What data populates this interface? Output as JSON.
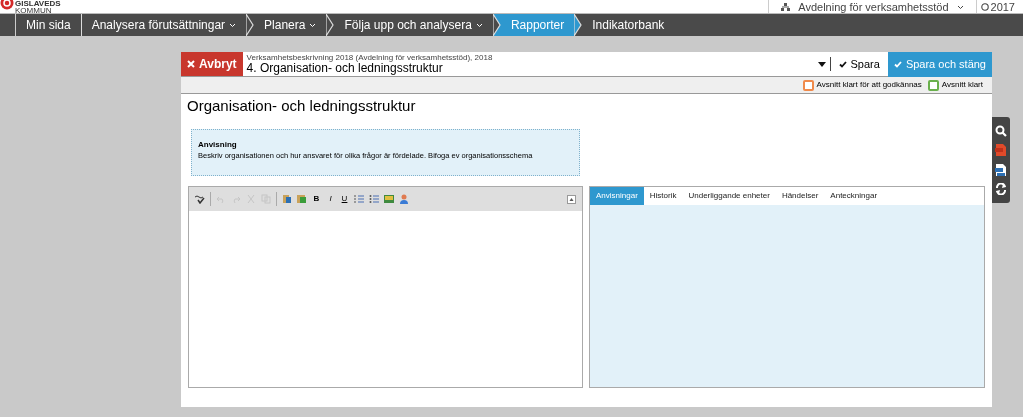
{
  "logo": {
    "line_1": "GISLAVEDS",
    "line_2": "KOMMUN"
  },
  "org_selector": {
    "label": "Avdelning för verksamhetsstöd"
  },
  "year": {
    "label": "2017"
  },
  "nav": [
    {
      "label": "Min sida",
      "has_dropdown": false,
      "selected": false
    },
    {
      "label": "Analysera förutsättningar",
      "has_dropdown": true,
      "selected": false
    },
    {
      "label": "Planera",
      "has_dropdown": true,
      "selected": false
    },
    {
      "label": "Följa upp och analysera",
      "has_dropdown": true,
      "selected": false
    },
    {
      "label": "Rapporter",
      "has_dropdown": false,
      "selected": true
    },
    {
      "label": "Indikatorbank",
      "has_dropdown": false,
      "selected": false
    }
  ],
  "dialog": {
    "cancel": "Avbryt",
    "breadcrumb": "Verksamhetsbeskrivning 2018 (Avdelning för verksamhetsstöd), 2018",
    "section": "4. Organisation- och ledningsstruktur",
    "save": "Spara",
    "save_close": "Spara och stäng",
    "status_checks": [
      {
        "label": "Avsnitt klart för att godkännas",
        "checked": false,
        "color": "#f08a4b"
      },
      {
        "label": "Avsnitt klart",
        "checked": false,
        "color": "#6ab04c"
      }
    ],
    "heading": "Organisation- och ledningsstruktur",
    "instruction": {
      "title": "Anvisning",
      "text": "Beskriv organisationen och hur ansvaret för olika frågor är fördelade. Bifoga ev organisationsschema"
    },
    "editor_toolbar": [
      {
        "kind": "spellcheck",
        "disabled": false
      },
      {
        "kind": "separator"
      },
      {
        "kind": "undo",
        "disabled": true
      },
      {
        "kind": "redo",
        "disabled": true
      },
      {
        "kind": "cut",
        "disabled": true
      },
      {
        "kind": "copy",
        "disabled": true
      },
      {
        "kind": "separator"
      },
      {
        "kind": "paste",
        "disabled": false
      },
      {
        "kind": "paste-word",
        "disabled": false
      },
      {
        "kind": "bold",
        "label": "B"
      },
      {
        "kind": "italic",
        "label": "I"
      },
      {
        "kind": "underline",
        "label": "U"
      },
      {
        "kind": "ordered-list",
        "disabled": false
      },
      {
        "kind": "bullet-list",
        "disabled": false
      },
      {
        "kind": "image",
        "disabled": false
      },
      {
        "kind": "user",
        "disabled": false
      }
    ],
    "tabs": [
      {
        "label": "Anvisningar",
        "selected": true
      },
      {
        "label": "Historik",
        "selected": false
      },
      {
        "label": "Underliggande enheter",
        "selected": false
      },
      {
        "label": "Händelser",
        "selected": false
      },
      {
        "label": "Anteckningar",
        "selected": false
      }
    ]
  },
  "side_tools": [
    {
      "kind": "search"
    },
    {
      "kind": "pdf"
    },
    {
      "kind": "word"
    },
    {
      "kind": "refresh"
    }
  ]
}
